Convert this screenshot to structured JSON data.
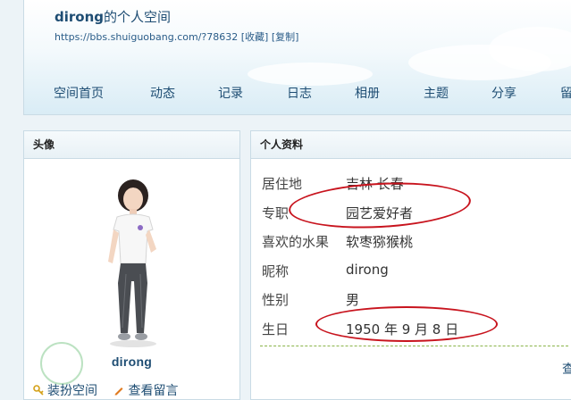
{
  "header": {
    "username": "dirong",
    "title_suffix": "的个人空间",
    "url": "https://bbs.shuiguobang.com/?78632",
    "favorite_link": "[收藏]",
    "copy_link": "[复制]"
  },
  "nav": {
    "items": [
      "空间首页",
      "动态",
      "记录",
      "日志",
      "相册",
      "主题",
      "分享",
      "留"
    ]
  },
  "avatar_panel": {
    "title": "头像",
    "name": "dirong",
    "links": [
      "装扮空间",
      "查看留言"
    ]
  },
  "profile_panel": {
    "title": "个人资料",
    "rows": [
      {
        "label": "居住地",
        "value": "吉林 长春"
      },
      {
        "label": "专职",
        "value": "园艺爱好者"
      },
      {
        "label": "喜欢的水果",
        "value": "软枣猕猴桃"
      },
      {
        "label": "昵称",
        "value": "dirong"
      },
      {
        "label": "性别",
        "value": "男"
      },
      {
        "label": "生日",
        "value": "1950 年 9 月 8 日"
      }
    ],
    "more_link": "查"
  },
  "colors": {
    "link": "#1e4d73",
    "annotation": "#c8141e",
    "separator": "#8ab44a"
  }
}
